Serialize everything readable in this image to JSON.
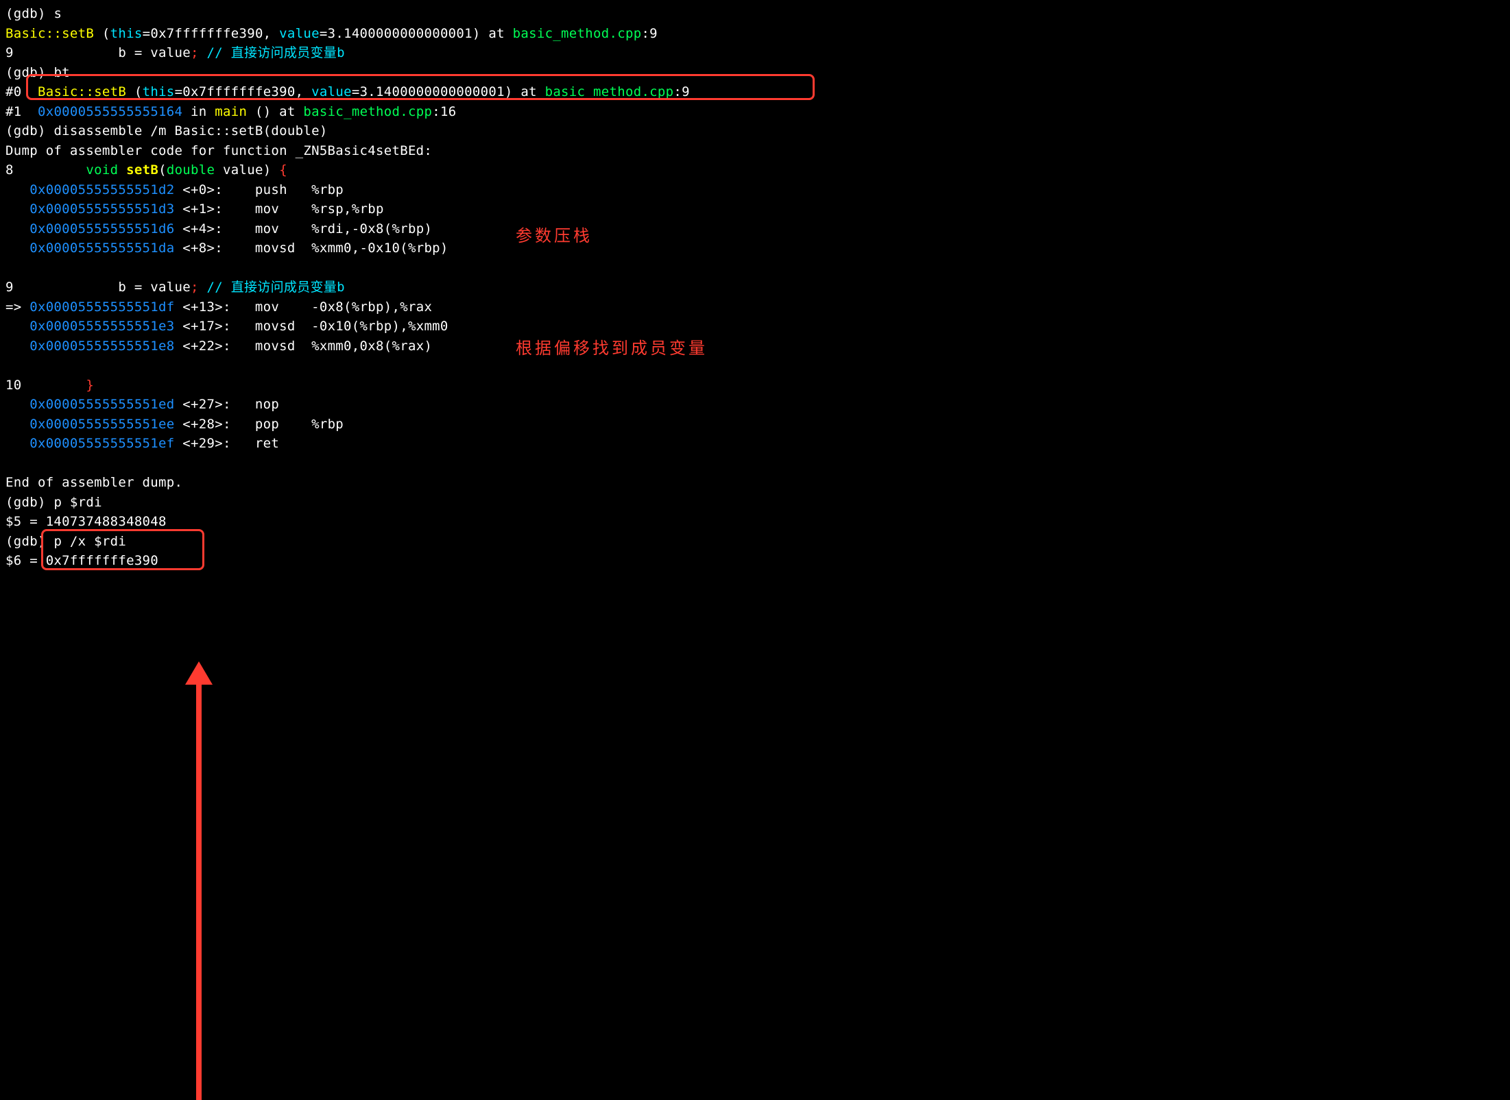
{
  "lines": {
    "l1_prompt": "(gdb) ",
    "l1_cmd": "s",
    "l2_fn": "Basic::setB",
    "l2_open": " (",
    "l2_this": "this",
    "l2_eq1": "=0x7fffffffe390, ",
    "l2_val": "value",
    "l2_eq2": "=3.1400000000000001) at ",
    "l2_file": "basic_method.cpp",
    "l2_loc": ":9",
    "l3_a": "9             b = value",
    "l3_semi": ";",
    "l3_comment": " // 直接访问成员变量b",
    "l4_prompt": "(gdb) ",
    "l4_cmd": "bt",
    "l5_pfx": "#0  ",
    "l5_fn": "Basic::setB",
    "l5_open": " (",
    "l5_this": "this",
    "l5_eq1": "=0x7fffffffe390, ",
    "l5_val": "value",
    "l5_eq2": "=3.1400000000000001) at ",
    "l5_file": "basic_method.cpp",
    "l5_loc": ":9",
    "l6_pfx": "#1  ",
    "l6_addr": "0x0000555555555164",
    "l6_in": " in ",
    "l6_main": "main",
    "l6_paren": " () at ",
    "l6_file": "basic_method.cpp",
    "l6_loc": ":16",
    "l7_prompt": "(gdb) ",
    "l7_cmd": "disassemble /m Basic::setB(double)",
    "l8": "Dump of assembler code for function _ZN5Basic4setBEd:",
    "l9_lineno": "8         ",
    "l9_void": "void",
    "l9_sp1": " ",
    "l9_setb": "setB",
    "l9_sp2": "(",
    "l9_dbl": "double",
    "l9_mid": " value",
    "l9_paren": ")",
    "l9_brace": " {",
    "asm": {
      "a1": "   0x00005555555551d2",
      "a1r": " <+0>:    push   %rbp",
      "a2": "   0x00005555555551d3",
      "a2r": " <+1>:    mov    %rsp,%rbp",
      "a3": "   0x00005555555551d6",
      "a3r": " <+4>:    mov    %rdi,-0x8(%rbp)",
      "a4": "   0x00005555555551da",
      "a4r": " <+8>:    movsd  %xmm0,-0x10(%rbp)"
    },
    "l10_a": "9             b = value",
    "l10_semi": ";",
    "l10_comment": " // 直接访问成员变量b",
    "cur_pfx": "=> ",
    "cur_addr": "0x00005555555551df",
    "cur_r": " <+13>:   mov    -0x8(%rbp),%rax",
    "b2": "   0x00005555555551e3",
    "b2r": " <+17>:   movsd  -0x10(%rbp),%xmm0",
    "b3": "   0x00005555555551e8",
    "b3r": " <+22>:   movsd  %xmm0,0x8(%rax)",
    "l11_lineno": "10        ",
    "l11_brace": "}",
    "c1": "   0x00005555555551ed",
    "c1r": " <+27>:   nop",
    "c2": "   0x00005555555551ee",
    "c2r": " <+28>:   pop    %rbp",
    "c3": "   0x00005555555551ef",
    "c3r": " <+29>:   ret",
    "end": "End of assembler dump.",
    "p1_prompt": "(gdb) ",
    "p1_cmd": "p $rdi",
    "p1_out": "$5 = 140737488348048",
    "p2_prompt": "(gdb) ",
    "p2_cmd": "p /x $rdi",
    "p2_out": "$6 = 0x7fffffffe390"
  },
  "annotations": {
    "anno1": "参数压栈",
    "anno2": "根据偏移找到成员变量"
  }
}
